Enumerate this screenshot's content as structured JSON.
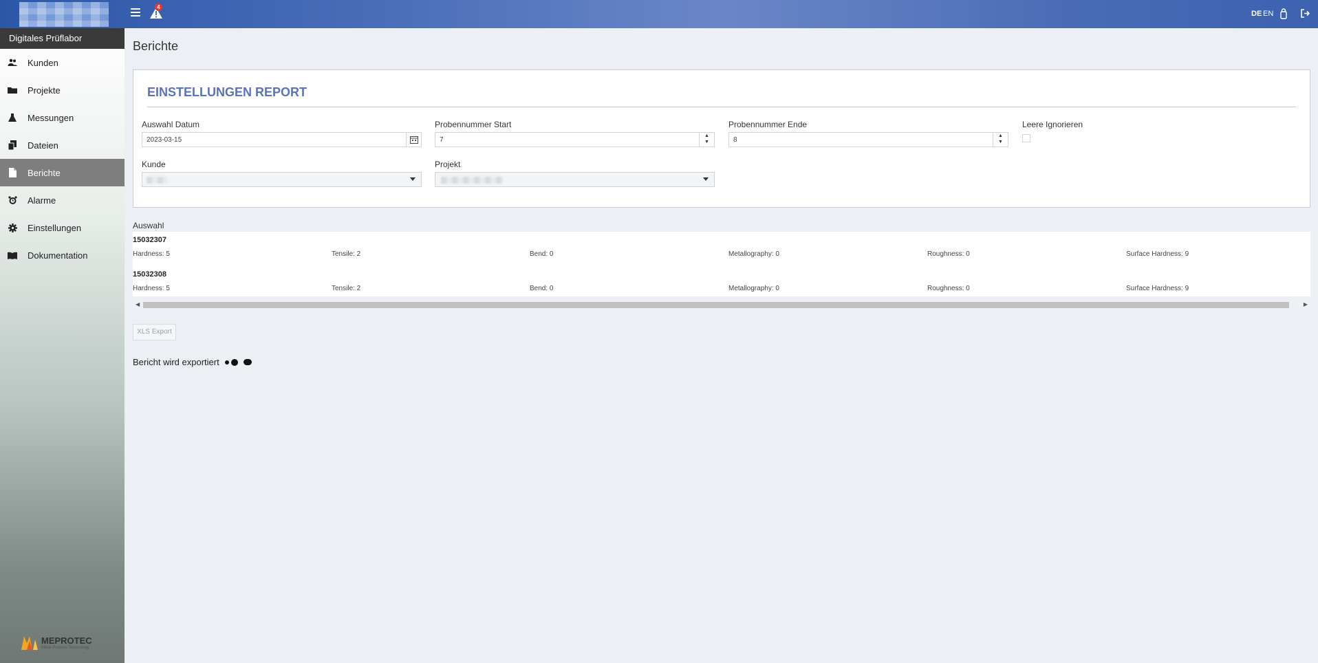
{
  "header": {
    "alert_count": "4",
    "lang_de": "DE",
    "lang_en": "EN"
  },
  "sidebar": {
    "title": "Digitales Prüflabor",
    "items": [
      {
        "label": "Kunden",
        "icon": "users-icon"
      },
      {
        "label": "Projekte",
        "icon": "folder-icon"
      },
      {
        "label": "Messungen",
        "icon": "flask-icon"
      },
      {
        "label": "Dateien",
        "icon": "files-icon"
      },
      {
        "label": "Berichte",
        "icon": "file-icon",
        "active": true
      },
      {
        "label": "Alarme",
        "icon": "alarm-clock-icon"
      },
      {
        "label": "Einstellungen",
        "icon": "gear-icon"
      },
      {
        "label": "Dokumentation",
        "icon": "book-icon"
      }
    ],
    "brand_name": "MEPROTEC",
    "brand_tagline": "Metal Process Technology"
  },
  "main": {
    "page_title": "Berichte",
    "card_title": "EINSTELLUNGEN REPORT",
    "fields": {
      "date_label": "Auswahl Datum",
      "date_value": "2023-03-15",
      "start_label": "Probennummer Start",
      "start_value": "7",
      "end_label": "Probennummer Ende",
      "end_value": "8",
      "ignore_label": "Leere Ignorieren",
      "customer_label": "Kunde",
      "project_label": "Projekt"
    },
    "selection_label": "Auswahl",
    "samples": [
      {
        "id": "15032307",
        "metrics": [
          "Hardness: 5",
          "Tensile: 2",
          "Bend: 0",
          "Metallography: 0",
          "Roughness: 0",
          "Surface Hardness: 9"
        ]
      },
      {
        "id": "15032308",
        "metrics": [
          "Hardness: 5",
          "Tensile: 2",
          "Bend: 0",
          "Metallography: 0",
          "Roughness: 0",
          "Surface Hardness: 9"
        ]
      }
    ],
    "xls_button": "XLS Export",
    "export_status": "Bericht wird exportiert"
  },
  "colors": {
    "accent": "#5b73b8",
    "topbar": "#4a6fba",
    "active_nav": "#7e7e7e",
    "alert_badge": "#e53935"
  }
}
